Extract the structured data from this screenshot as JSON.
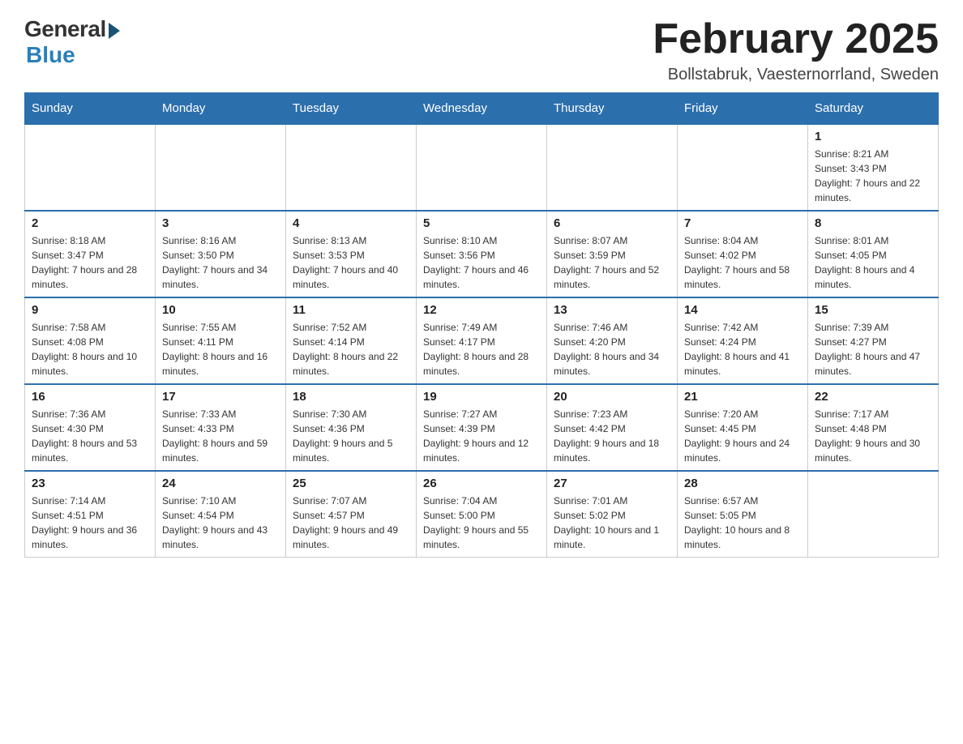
{
  "logo": {
    "general": "General",
    "blue": "Blue"
  },
  "title": "February 2025",
  "location": "Bollstabruk, Vaesternorrland, Sweden",
  "days_of_week": [
    "Sunday",
    "Monday",
    "Tuesday",
    "Wednesday",
    "Thursday",
    "Friday",
    "Saturday"
  ],
  "weeks": [
    [
      {
        "day": "",
        "info": ""
      },
      {
        "day": "",
        "info": ""
      },
      {
        "day": "",
        "info": ""
      },
      {
        "day": "",
        "info": ""
      },
      {
        "day": "",
        "info": ""
      },
      {
        "day": "",
        "info": ""
      },
      {
        "day": "1",
        "info": "Sunrise: 8:21 AM\nSunset: 3:43 PM\nDaylight: 7 hours and 22 minutes."
      }
    ],
    [
      {
        "day": "2",
        "info": "Sunrise: 8:18 AM\nSunset: 3:47 PM\nDaylight: 7 hours and 28 minutes."
      },
      {
        "day": "3",
        "info": "Sunrise: 8:16 AM\nSunset: 3:50 PM\nDaylight: 7 hours and 34 minutes."
      },
      {
        "day": "4",
        "info": "Sunrise: 8:13 AM\nSunset: 3:53 PM\nDaylight: 7 hours and 40 minutes."
      },
      {
        "day": "5",
        "info": "Sunrise: 8:10 AM\nSunset: 3:56 PM\nDaylight: 7 hours and 46 minutes."
      },
      {
        "day": "6",
        "info": "Sunrise: 8:07 AM\nSunset: 3:59 PM\nDaylight: 7 hours and 52 minutes."
      },
      {
        "day": "7",
        "info": "Sunrise: 8:04 AM\nSunset: 4:02 PM\nDaylight: 7 hours and 58 minutes."
      },
      {
        "day": "8",
        "info": "Sunrise: 8:01 AM\nSunset: 4:05 PM\nDaylight: 8 hours and 4 minutes."
      }
    ],
    [
      {
        "day": "9",
        "info": "Sunrise: 7:58 AM\nSunset: 4:08 PM\nDaylight: 8 hours and 10 minutes."
      },
      {
        "day": "10",
        "info": "Sunrise: 7:55 AM\nSunset: 4:11 PM\nDaylight: 8 hours and 16 minutes."
      },
      {
        "day": "11",
        "info": "Sunrise: 7:52 AM\nSunset: 4:14 PM\nDaylight: 8 hours and 22 minutes."
      },
      {
        "day": "12",
        "info": "Sunrise: 7:49 AM\nSunset: 4:17 PM\nDaylight: 8 hours and 28 minutes."
      },
      {
        "day": "13",
        "info": "Sunrise: 7:46 AM\nSunset: 4:20 PM\nDaylight: 8 hours and 34 minutes."
      },
      {
        "day": "14",
        "info": "Sunrise: 7:42 AM\nSunset: 4:24 PM\nDaylight: 8 hours and 41 minutes."
      },
      {
        "day": "15",
        "info": "Sunrise: 7:39 AM\nSunset: 4:27 PM\nDaylight: 8 hours and 47 minutes."
      }
    ],
    [
      {
        "day": "16",
        "info": "Sunrise: 7:36 AM\nSunset: 4:30 PM\nDaylight: 8 hours and 53 minutes."
      },
      {
        "day": "17",
        "info": "Sunrise: 7:33 AM\nSunset: 4:33 PM\nDaylight: 8 hours and 59 minutes."
      },
      {
        "day": "18",
        "info": "Sunrise: 7:30 AM\nSunset: 4:36 PM\nDaylight: 9 hours and 5 minutes."
      },
      {
        "day": "19",
        "info": "Sunrise: 7:27 AM\nSunset: 4:39 PM\nDaylight: 9 hours and 12 minutes."
      },
      {
        "day": "20",
        "info": "Sunrise: 7:23 AM\nSunset: 4:42 PM\nDaylight: 9 hours and 18 minutes."
      },
      {
        "day": "21",
        "info": "Sunrise: 7:20 AM\nSunset: 4:45 PM\nDaylight: 9 hours and 24 minutes."
      },
      {
        "day": "22",
        "info": "Sunrise: 7:17 AM\nSunset: 4:48 PM\nDaylight: 9 hours and 30 minutes."
      }
    ],
    [
      {
        "day": "23",
        "info": "Sunrise: 7:14 AM\nSunset: 4:51 PM\nDaylight: 9 hours and 36 minutes."
      },
      {
        "day": "24",
        "info": "Sunrise: 7:10 AM\nSunset: 4:54 PM\nDaylight: 9 hours and 43 minutes."
      },
      {
        "day": "25",
        "info": "Sunrise: 7:07 AM\nSunset: 4:57 PM\nDaylight: 9 hours and 49 minutes."
      },
      {
        "day": "26",
        "info": "Sunrise: 7:04 AM\nSunset: 5:00 PM\nDaylight: 9 hours and 55 minutes."
      },
      {
        "day": "27",
        "info": "Sunrise: 7:01 AM\nSunset: 5:02 PM\nDaylight: 10 hours and 1 minute."
      },
      {
        "day": "28",
        "info": "Sunrise: 6:57 AM\nSunset: 5:05 PM\nDaylight: 10 hours and 8 minutes."
      },
      {
        "day": "",
        "info": ""
      }
    ]
  ]
}
